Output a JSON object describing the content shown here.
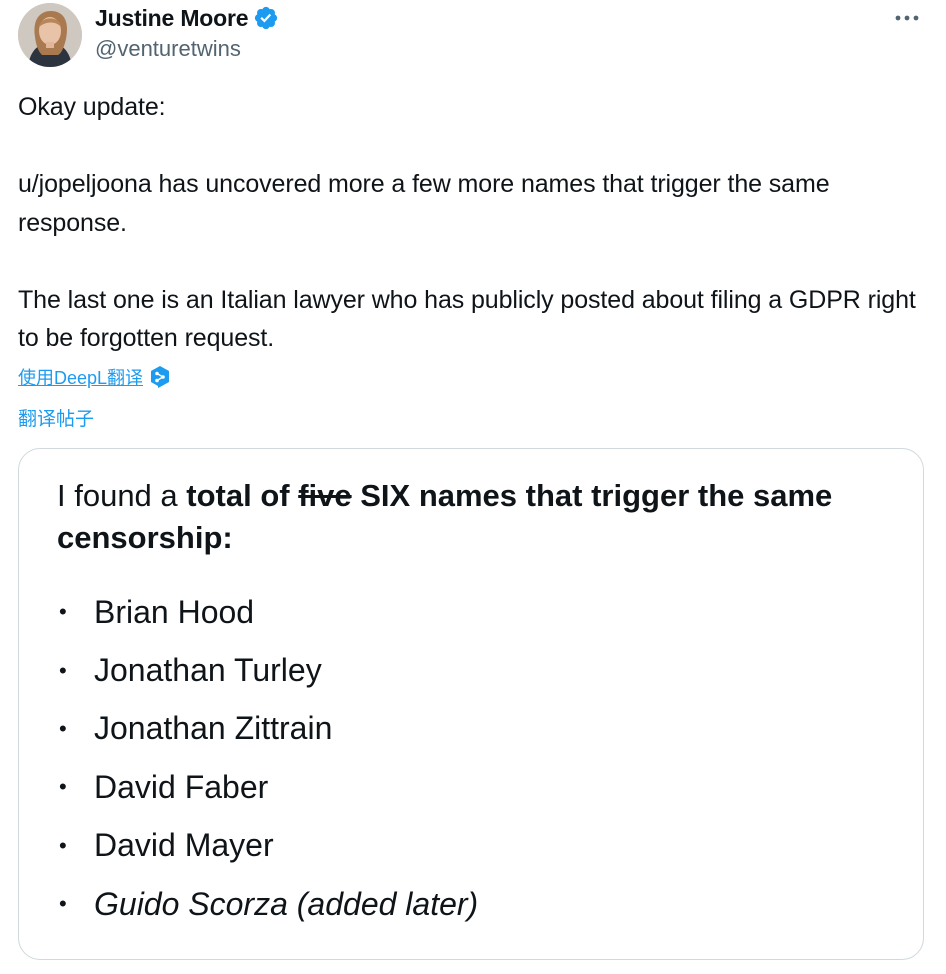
{
  "author": {
    "display_name": "Justine Moore",
    "handle": "@venturetwins",
    "verified": true,
    "avatar_icon": "user-avatar-photo"
  },
  "more_icon": "more-horizontal-icon",
  "tweet": {
    "paragraphs": [
      "Okay update:",
      "u/jopeljoona has uncovered more a few more names that trigger the same response.",
      "The last one is an Italian lawyer who has publicly posted about filing a GDPR right to be forgotten request."
    ]
  },
  "translate": {
    "deepl_label": "使用DeepL翻译",
    "post_label": "翻译帖子"
  },
  "card": {
    "heading_prefix": "I found a ",
    "heading_bold_1": "total of ",
    "heading_strike": "five",
    "heading_bold_2": " SIX names that trigger the same censorship:",
    "names": [
      "Brian Hood",
      "Jonathan Turley",
      "Jonathan Zittrain",
      "David Faber",
      "David Mayer",
      "Guido Scorza (added later)"
    ],
    "bullet": "•"
  },
  "colors": {
    "link": "#1d9bf0",
    "text": "#0f1419",
    "muted": "#536471",
    "border": "#cfd9de"
  }
}
